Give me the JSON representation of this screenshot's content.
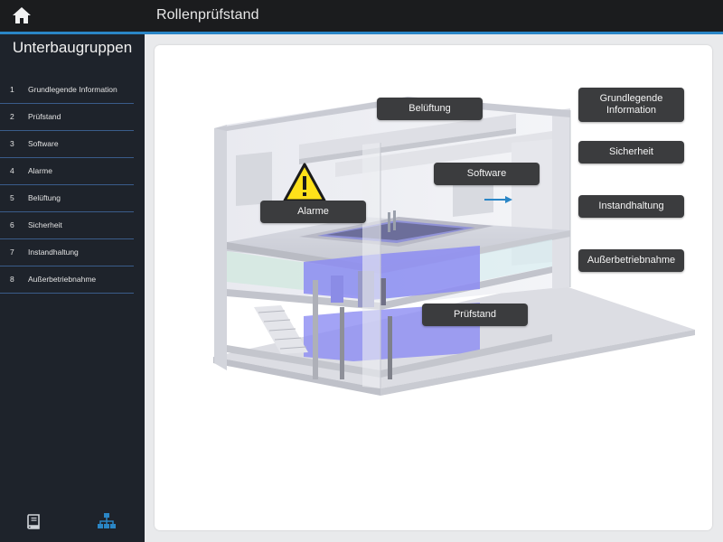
{
  "header": {
    "title": "Rollenprüfstand",
    "home_icon": "home-icon"
  },
  "sidebar": {
    "title": "Unterbaugruppen",
    "items": [
      {
        "num": "1",
        "label": "Grundlegende Information"
      },
      {
        "num": "2",
        "label": "Prüfstand"
      },
      {
        "num": "3",
        "label": "Software"
      },
      {
        "num": "4",
        "label": "Alarme"
      },
      {
        "num": "5",
        "label": "Belüftung"
      },
      {
        "num": "6",
        "label": "Sicherheit"
      },
      {
        "num": "7",
        "label": "Instandhaltung"
      },
      {
        "num": "8",
        "label": "Außerbetriebnahme"
      }
    ],
    "footer_icons": [
      "book-icon",
      "sitemap-icon"
    ]
  },
  "diagram": {
    "labels": {
      "belueftung": "Belüftung",
      "software": "Software",
      "alarme": "Alarme",
      "pruefstand": "Prüfstand"
    }
  },
  "right_buttons": [
    {
      "label": "Grundlegende Information"
    },
    {
      "label": "Sicherheit"
    },
    {
      "label": "Instandhaltung"
    },
    {
      "label": "Außerbetriebnahme"
    }
  ],
  "colors": {
    "accent": "#2a86c6",
    "sidebar_bg": "#1e232b",
    "topbar_bg": "#1b1c1e",
    "tag_bg": "#3b3c3e",
    "machine": "#8c8cf2",
    "warning": "#ffe11a"
  }
}
